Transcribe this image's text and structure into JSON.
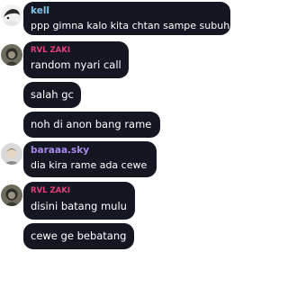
{
  "colors": {
    "bubble_bg": "#141722",
    "message_text": "#ffffff",
    "name_kell": "#7ec3e8",
    "name_rvl_zaki": "#e0407a",
    "name_baraaa_sky": "#a687e8"
  },
  "messages": [
    {
      "author": "kell",
      "text": "ppp gimna kalo kita chtan sampe subuh"
    },
    {
      "author": "RVL ZAKI",
      "text": "random nyari call"
    },
    {
      "author": null,
      "text": "salah gc"
    },
    {
      "author": null,
      "text": "noh di anon bang rame"
    },
    {
      "author": "baraaa.sky",
      "text": "dia kira rame ada cewe"
    },
    {
      "author": "RVL ZAKI",
      "text": "disini batang mulu"
    },
    {
      "author": null,
      "text": "cewe ge bebatang"
    }
  ]
}
